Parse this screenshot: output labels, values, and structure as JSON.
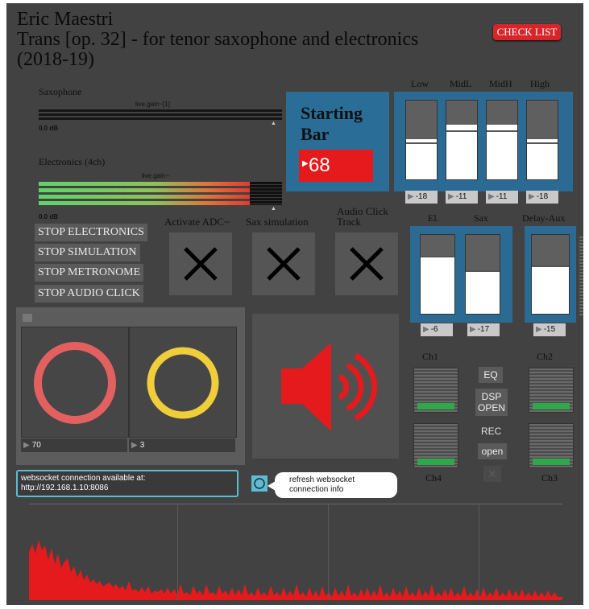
{
  "header": {
    "composer": "Eric Maestri",
    "work": "Trans [op. 32] - for tenor saxophone and electronics",
    "years": "(2018-19)",
    "checklist_label": "CHECK LIST"
  },
  "gains": {
    "sax_label": "Saxophone",
    "sax_object": "live.gain~[1]",
    "sax_db": "0.0 dB",
    "elec_label": "Electronics (4ch)",
    "elec_object": "live.gain~",
    "elec_db": "0.0 dB"
  },
  "starting_bar": {
    "label_line1": "Starting",
    "label_line2": "Bar",
    "value": "68"
  },
  "eq": {
    "bands": [
      {
        "label": "Low",
        "value": "-18"
      },
      {
        "label": "MidL",
        "value": "-11"
      },
      {
        "label": "MidH",
        "value": "-11"
      },
      {
        "label": "High",
        "value": "-18"
      }
    ]
  },
  "mix": {
    "faders": [
      {
        "label": "El.",
        "value": "-6"
      },
      {
        "label": "Sax",
        "value": "-17"
      },
      {
        "label": "Delay-Aux",
        "value": "-15"
      }
    ]
  },
  "stop_buttons": [
    "STOP ELECTRONICS",
    "STOP SIMULATION",
    "STOP METRONOME",
    "STOP AUDIO CLICK"
  ],
  "toggles": [
    {
      "label": "Activate ADC~"
    },
    {
      "label": "Sax simulation"
    },
    {
      "label_line1": "Audio Click",
      "label_line2": "Track"
    }
  ],
  "dials": {
    "left_value": "70",
    "right_value": "3",
    "left_color": "#e26160",
    "right_color": "#f0cd3a"
  },
  "meters": {
    "ch1": "Ch1",
    "ch2": "Ch2",
    "ch3": "Ch3",
    "ch4": "Ch4"
  },
  "controls": {
    "eq_label": "EQ",
    "dsp_line1": "DSP",
    "dsp_line2": "OPEN",
    "rec_label": "REC",
    "open_label": "open"
  },
  "websocket": {
    "line1": "websocket connection available at:",
    "line2": "http://192.168.1.10:8086",
    "refresh_line1": "refresh websocket",
    "refresh_line2": "connection info"
  },
  "colors": {
    "accent_red": "#e41a1c",
    "panel_blue": "#2a6e98",
    "green": "#2ea84a"
  }
}
